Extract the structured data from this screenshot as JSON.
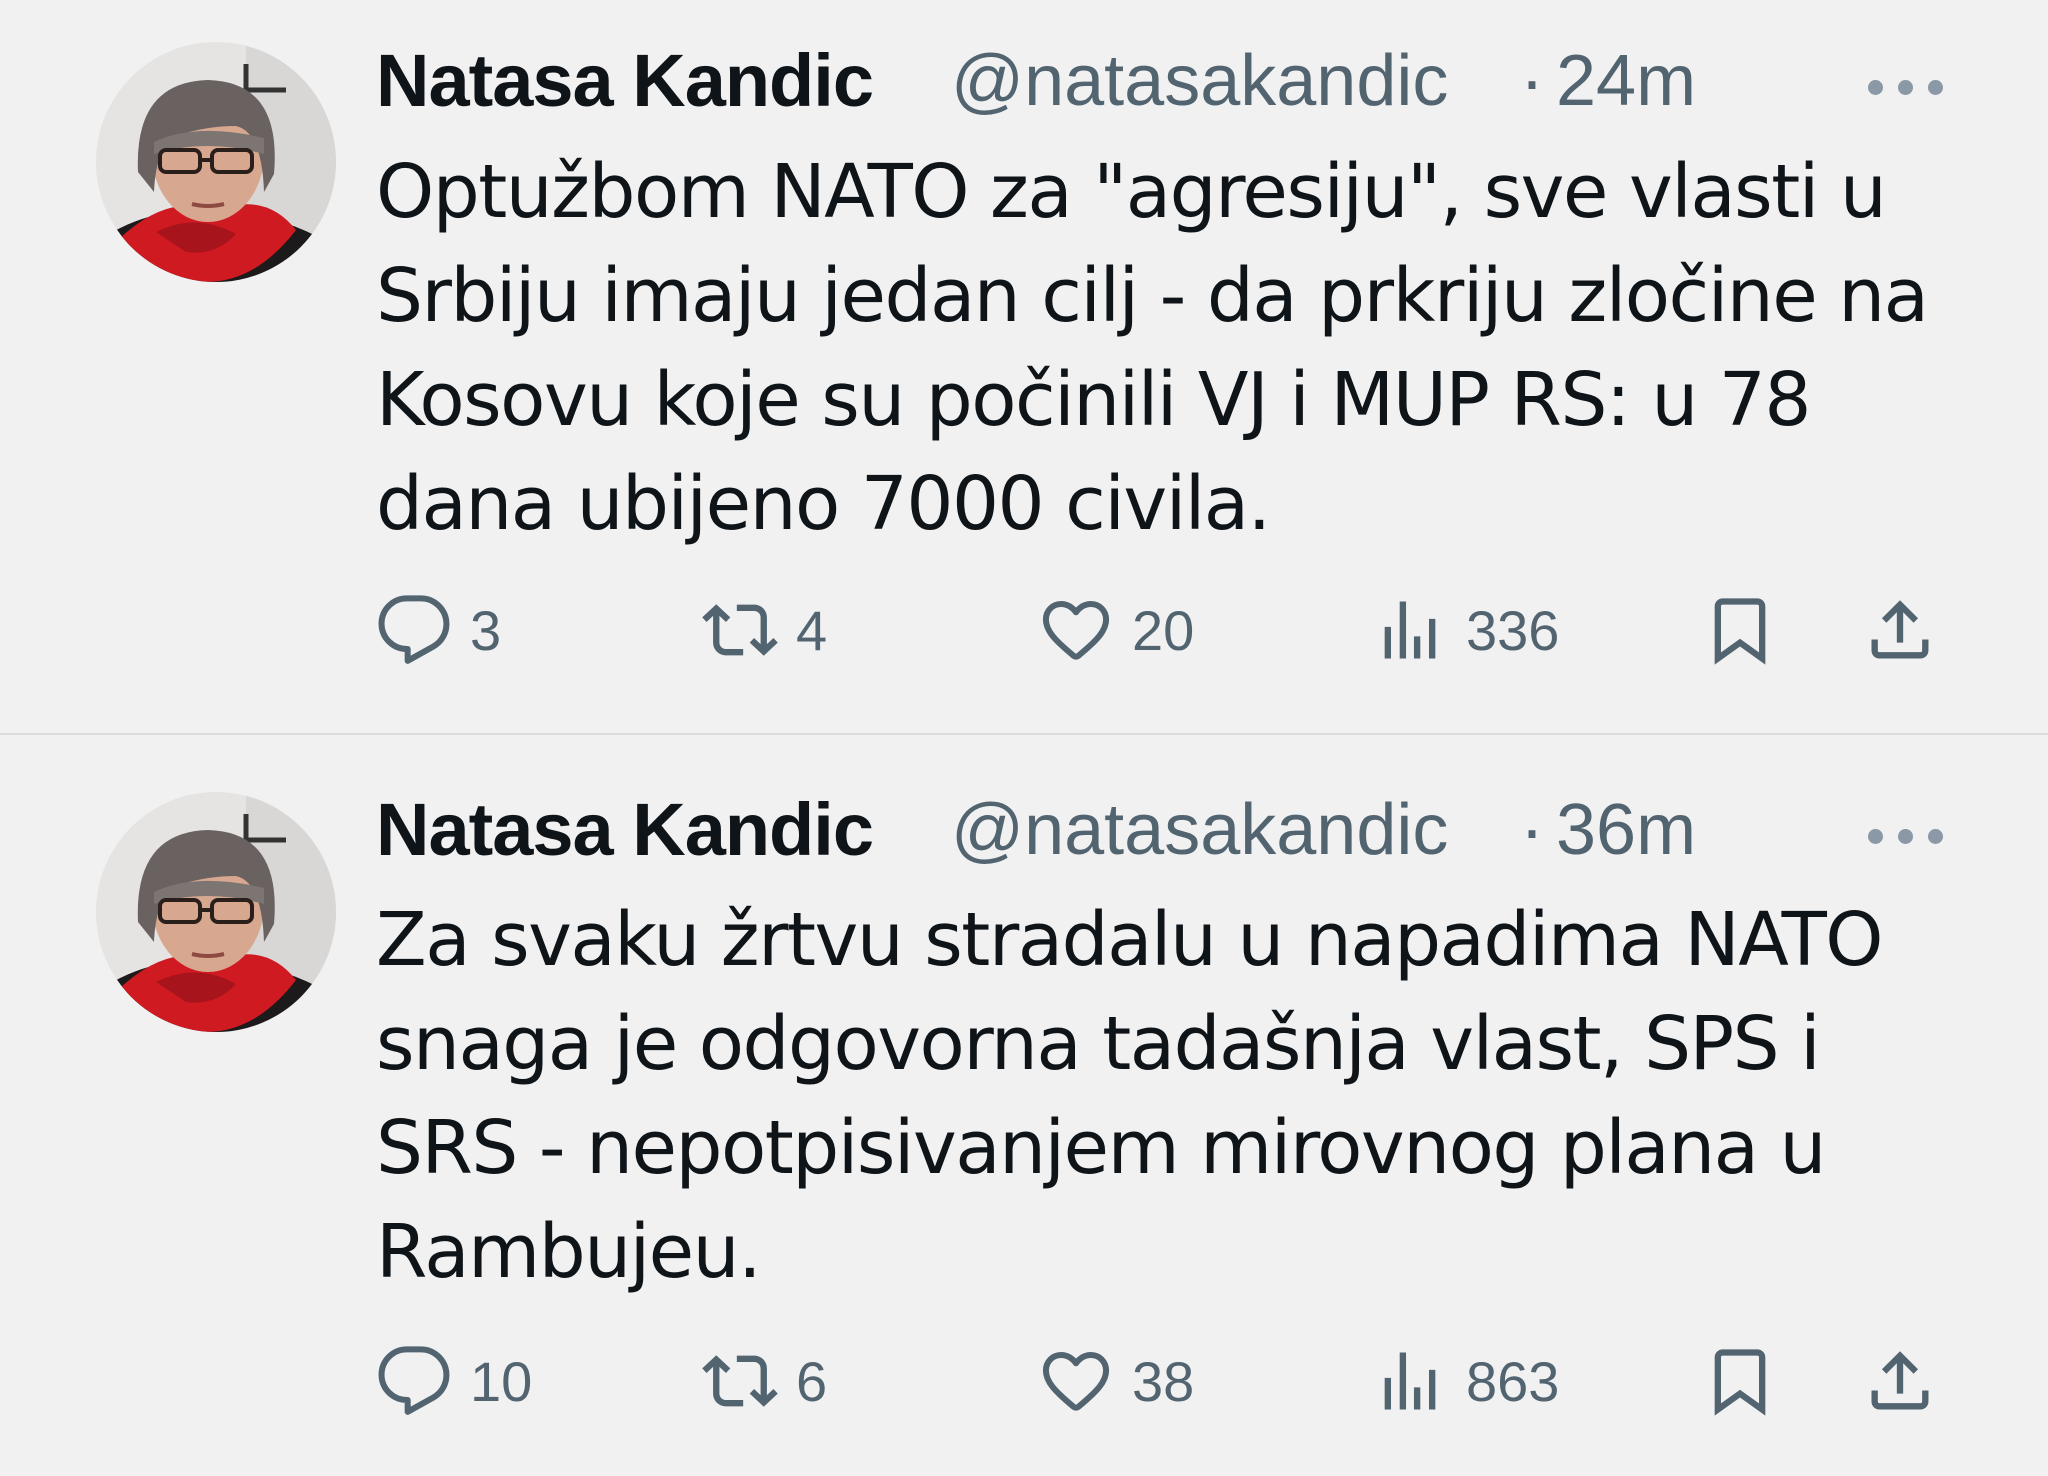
{
  "tweets": [
    {
      "author": {
        "name": "Natasa Kandic",
        "handle": "@natasakandic",
        "avatar_icon": "profile-photo"
      },
      "separator": "·",
      "time": "24m",
      "text_lines": [
        "Optužbom NATO za \"agresiju\", sve vlasti u",
        "Srbiju imaju jedan cilj - da prkriju zločine na",
        "Kosovu koje su počinili VJ i MUP RS: u 78",
        "dana ubijeno 7000 civila."
      ],
      "stats": {
        "replies": "3",
        "retweets": "4",
        "likes": "20",
        "views": "336"
      }
    },
    {
      "author": {
        "name": "Natasa Kandic",
        "handle": "@natasakandic",
        "avatar_icon": "profile-photo"
      },
      "separator": "·",
      "time": "36m",
      "text_lines": [
        "Za svaku žrtvu stradalu u napadima NATO",
        "snaga je odgovorna tadašnja vlast, SPS i",
        "SRS - nepotpisivanjem mirovnog plana u",
        "Rambujeu."
      ],
      "stats": {
        "replies": "10",
        "retweets": "6",
        "likes": "38",
        "views": "863"
      }
    }
  ],
  "icons": {
    "reply": "reply-icon",
    "retweet": "retweet-icon",
    "like": "like-icon",
    "views": "views-icon",
    "bookmark": "bookmark-icon",
    "share": "share-icon",
    "more": "more-icon"
  },
  "colors": {
    "background": "#f1f1f1",
    "text": "#0f1419",
    "secondary": "#536471"
  }
}
